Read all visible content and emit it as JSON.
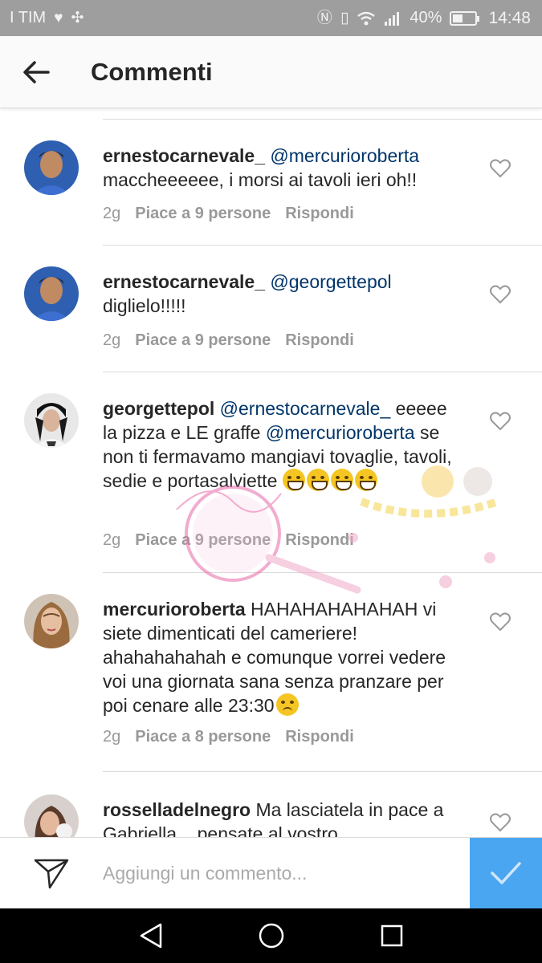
{
  "status_bar": {
    "carrier": "I TIM",
    "battery_percent": "40%",
    "battery_level": 0.4,
    "time": "14:48"
  },
  "header": {
    "title": "Commenti",
    "back_icon": "arrow-left-icon"
  },
  "comments": [
    {
      "username": "ernestocarnevale_",
      "mention1": "@mercurioroberta",
      "text": "maccheeeeee, i morsi ai tavoli ieri oh!!",
      "time": "2g",
      "likes": "Piace a 9 persone",
      "reply": "Rispondi"
    },
    {
      "username": "ernestocarnevale_",
      "mention1": "@georgettepol",
      "text": "diglielo!!!!!",
      "time": "2g",
      "likes": "Piace a 9 persone",
      "reply": "Rispondi"
    },
    {
      "username": "georgettepol",
      "mention1": "@ernestocarnevale_",
      "text1": "eeeee la pizza e LE graffe",
      "mention2": "@mercurioroberta",
      "text2": " se non ti fermavamo mangiavi tovaglie, tavoli, sedie e portasalviette ",
      "time": "2g",
      "likes": "Piace a 9 persone",
      "reply": "Rispondi"
    },
    {
      "username": "mercurioroberta",
      "text": " HAHAHAHAHAHAH vi siete dimenticati del cameriere! ahahahahahah e comunque vorrei vedere voi una giornata sana senza pranzare per poi cenare alle 23:30",
      "time": "2g",
      "likes": "Piace a 8 persone",
      "reply": "Rispondi"
    },
    {
      "username": "rosselladelnegro",
      "text": " Ma lasciatela in pace a Gabriella... pensate al vostro"
    }
  ],
  "input": {
    "placeholder": "Aggiungi un commento..."
  },
  "colors": {
    "accent": "#4aa6f0",
    "mention": "#003569",
    "status_bar": "#9e9e9e"
  }
}
